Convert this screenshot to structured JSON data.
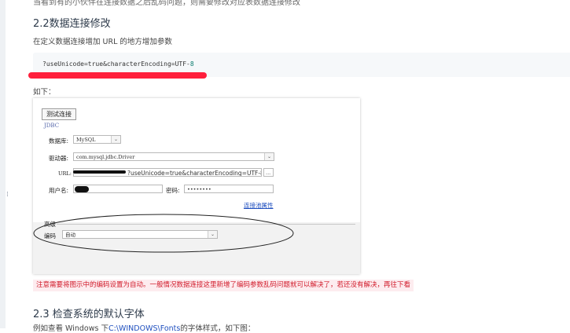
{
  "cut_text": "当看到有的小伙伴在连接数据之后乱码问题，则需要修改对应表数据连接修改",
  "section_title": "2.2数据连接修改",
  "intro": "在定义数据连接增加 URL 的地方增加参数",
  "code": {
    "text": "?useUnicode=true&characterEncoding=UTF-",
    "num": "8"
  },
  "as_below": "如下：",
  "dialog": {
    "test_button": "测试连接",
    "jdbc_label": "JDBC",
    "db_label": "数据库:",
    "db_value": "MySQL",
    "driver_label": "驱动器:",
    "driver_value": "com.mysql.jdbc.Driver",
    "url_label": "URL:",
    "url_value": "?useUnicode=true&characterEncoding=UTF-8",
    "url_button": "...",
    "user_label": "用户名:",
    "password_label": "密码:",
    "password_value": "••••••••",
    "conn_props_link": "连接池属性",
    "advanced_label": "高级",
    "encoding_label": "编码",
    "encoding_value": "自动"
  },
  "note": "注意需要将图示中的编码设置为自动。一般情况数据连接这里新增了编码参数乱码问题就可以解决了，若还没有解决，再往下看",
  "section2_title": "2.3 检查系统的默认字体",
  "section2_intro_a": "例如查看 Windows 下",
  "section2_path": "C:\\WINDOWS\\Fonts",
  "section2_intro_b": "的字体样式，如下图：",
  "colors": {
    "accent_red": "#ff1f3c",
    "note_bg": "#fdecef",
    "link": "#1f4fbf"
  },
  "icons": [
    "drag-handle-icon",
    "chevron-down-icon"
  ]
}
